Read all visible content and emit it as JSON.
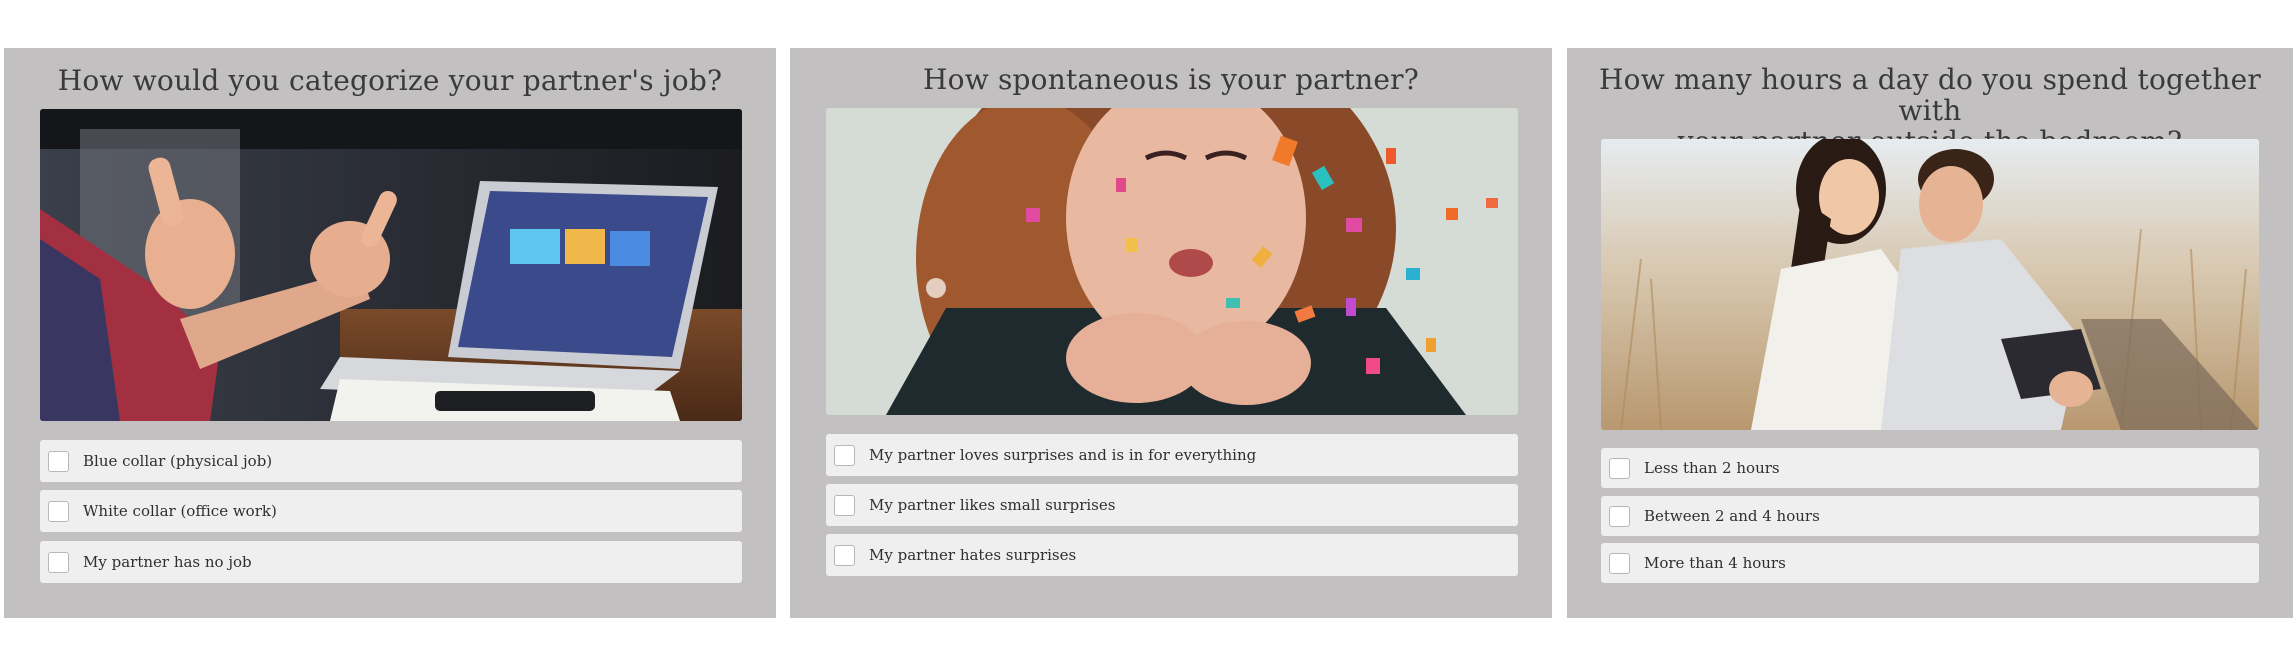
{
  "questions": [
    {
      "title": "How would you categorize your partner's job?",
      "image": "laptop-meeting-photo",
      "options": [
        "Blue collar (physical job)",
        "White collar (office work)",
        "My partner has no job"
      ]
    },
    {
      "title": "How spontaneous is your partner?",
      "image": "confetti-blowing-photo",
      "options": [
        "My partner loves surprises and is in for everything",
        "My partner likes small surprises",
        "My partner hates surprises"
      ]
    },
    {
      "title_line1": "How many hours a day do you spend together with",
      "title_line2": "your partner outside the bedroom?",
      "image": "laughing-couple-photo",
      "options": [
        "Less than 2 hours",
        "Between 2 and 4 hours",
        "More than 4 hours"
      ]
    }
  ],
  "colors": {
    "card_bg": "#c2c0c1",
    "option_bg": "#efefef",
    "text": "#333333"
  }
}
